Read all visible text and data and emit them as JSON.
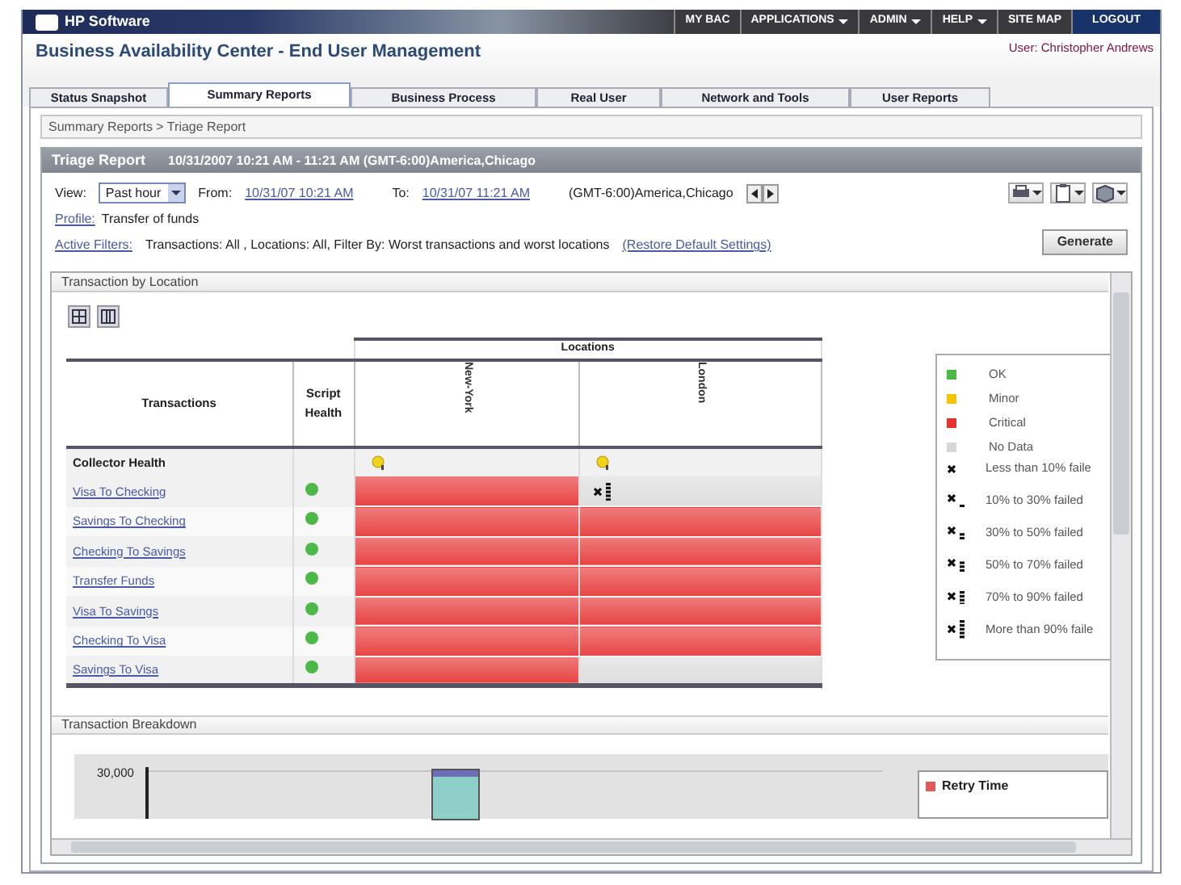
{
  "header": {
    "logo": "HP Software",
    "nav": [
      {
        "label": "MY BAC",
        "dropdown": false,
        "highlight": false
      },
      {
        "label": "APPLICATIONS",
        "dropdown": true,
        "highlight": false
      },
      {
        "label": "ADMIN",
        "dropdown": true,
        "highlight": false
      },
      {
        "label": "HELP",
        "dropdown": true,
        "highlight": false
      },
      {
        "label": "SITE MAP",
        "dropdown": false,
        "highlight": false
      },
      {
        "label": "LOGOUT",
        "dropdown": false,
        "highlight": true
      }
    ]
  },
  "app_title": "Business Availability Center - End User Management",
  "user": "User: Christopher Andrews",
  "tabs": [
    {
      "label": "Status Snapshot",
      "selected": false
    },
    {
      "label": "Summary Reports",
      "selected": true
    },
    {
      "label": "Business Process",
      "selected": false
    },
    {
      "label": "Real User",
      "selected": false
    },
    {
      "label": "Network and Tools",
      "selected": false
    },
    {
      "label": "User Reports",
      "selected": false
    }
  ],
  "breadcrumb": "Summary Reports > Triage Report",
  "report": {
    "title": "Triage Report",
    "range": "10/31/2007 10:21 AM - 11:21 AM (GMT-6:00)America,Chicago",
    "view_label": "View:",
    "view_value": "Past hour",
    "from_label": "From:",
    "from": "10/31/07 10:21 AM",
    "to_label": "To:",
    "to": "10/31/07 11:21 AM",
    "timezone": "(GMT-6:00)America,Chicago",
    "profile_label": "Profile:",
    "profile": "Transfer of funds",
    "filters_label": "Active Filters:",
    "filters": "Transactions: All , Locations: All, Filter By: Worst transactions and worst locations",
    "restore": "(Restore Default Settings)",
    "generate": "Generate"
  },
  "location_section": {
    "title": "Transaction by Location",
    "group_header": "Locations",
    "columns": [
      "Transactions",
      "Script Health",
      "New-York",
      "London"
    ],
    "collector_row": {
      "label": "Collector Health",
      "cells": [
        {
          "kind": "collector"
        },
        {
          "kind": "collector"
        }
      ]
    },
    "rows": [
      {
        "name": "Visa To Checking",
        "health": {
          "color": "#4cb848"
        },
        "cells": [
          {
            "color": "#e84444",
            "failed": false
          },
          {
            "color": "#dedede",
            "failed": true
          }
        ]
      },
      {
        "name": "Savings To Checking",
        "health": {
          "color": "#4cb848"
        },
        "cells": [
          {
            "color": "#e84444",
            "failed": false
          },
          {
            "color": "#e84444",
            "failed": false
          }
        ]
      },
      {
        "name": "Checking To Savings",
        "health": {
          "color": "#4cb848"
        },
        "cells": [
          {
            "color": "#e84444",
            "failed": false
          },
          {
            "color": "#e84444",
            "failed": false
          }
        ]
      },
      {
        "name": "Transfer Funds",
        "health": {
          "color": "#4cb848"
        },
        "cells": [
          {
            "color": "#e84444",
            "failed": false
          },
          {
            "color": "#e84444",
            "failed": false
          }
        ]
      },
      {
        "name": "Visa To Savings",
        "health": {
          "color": "#4cb848"
        },
        "cells": [
          {
            "color": "#e84444",
            "failed": false
          },
          {
            "color": "#e84444",
            "failed": false
          }
        ]
      },
      {
        "name": "Checking To Visa",
        "health": {
          "color": "#4cb848"
        },
        "cells": [
          {
            "color": "#e84444",
            "failed": false
          },
          {
            "color": "#e84444",
            "failed": false
          }
        ]
      },
      {
        "name": "Savings To Visa",
        "health": {
          "color": "#4cb848"
        },
        "cells": [
          {
            "color": "#e84444",
            "failed": false
          },
          {
            "color": "#dedede",
            "failed": false
          }
        ]
      }
    ],
    "legend": [
      {
        "kind": "color",
        "label": "OK",
        "color": "#4cb848"
      },
      {
        "kind": "color",
        "label": "Minor",
        "color": "#f5c400"
      },
      {
        "kind": "color",
        "label": "Critical",
        "color": "#e83030"
      },
      {
        "kind": "color",
        "label": "No Data",
        "color": "#d6d6d6"
      },
      {
        "kind": "failed",
        "label": "Less than 10% faile"
      },
      {
        "kind": "failed",
        "label": "10% to 30% failed"
      },
      {
        "kind": "failed",
        "label": "30% to 50% failed"
      },
      {
        "kind": "failed",
        "label": "50% to 70% failed"
      },
      {
        "kind": "failed",
        "label": "70% to 90% failed"
      },
      {
        "kind": "failed",
        "label": "More than 90% faile"
      }
    ]
  },
  "breakdown_section": {
    "title": "Transaction Breakdown",
    "y_tick": "30,000",
    "legend": [
      {
        "label": "Retry Time",
        "color": "#e05a5a"
      }
    ]
  }
}
